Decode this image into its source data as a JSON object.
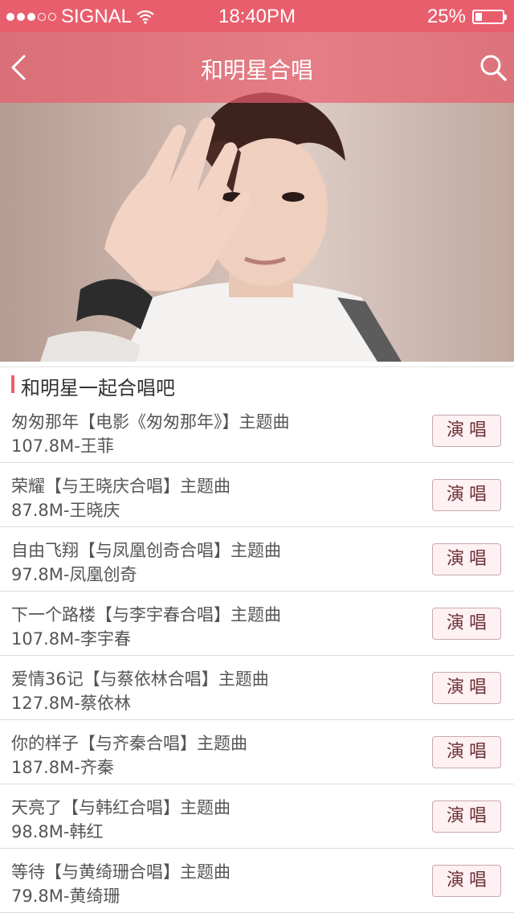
{
  "status_bar": {
    "carrier": "SIGNAL",
    "time": "18:40PM",
    "battery_text": "25%",
    "battery_level": 0.25,
    "signal_strength": 3,
    "signal_max": 5
  },
  "nav": {
    "title": "和明星合唱",
    "back_icon": "chevron-left-icon",
    "search_icon": "search-icon"
  },
  "colors": {
    "accent": "#e95e6d",
    "button_bg": "#fdf1f3",
    "button_text": "#6d2f36"
  },
  "section": {
    "title": "和明星一起合唱吧"
  },
  "songs": [
    {
      "title": "匆匆那年【电影《匆匆那年》】主题曲",
      "meta": "107.8M-王菲",
      "action": "演唱"
    },
    {
      "title": "荣耀【与王晓庆合唱】主题曲",
      "meta": "87.8M-王晓庆",
      "action": "演唱"
    },
    {
      "title": "自由飞翔【与凤凰创奇合唱】主题曲",
      "meta": "97.8M-凤凰创奇",
      "action": "演唱"
    },
    {
      "title": "下一个路楼【与李宇春合唱】主题曲",
      "meta": "107.8M-李宇春",
      "action": "演唱"
    },
    {
      "title": "爱情36记【与蔡依林合唱】主题曲",
      "meta": "127.8M-蔡依林",
      "action": "演唱"
    },
    {
      "title": "你的样子【与齐秦合唱】主题曲",
      "meta": "187.8M-齐秦",
      "action": "演唱"
    },
    {
      "title": "天亮了【与韩红合唱】主题曲",
      "meta": "98.8M-韩红",
      "action": "演唱"
    },
    {
      "title": "等待【与黄绮珊合唱】主题曲",
      "meta": "79.8M-黄绮珊",
      "action": "演唱"
    }
  ]
}
